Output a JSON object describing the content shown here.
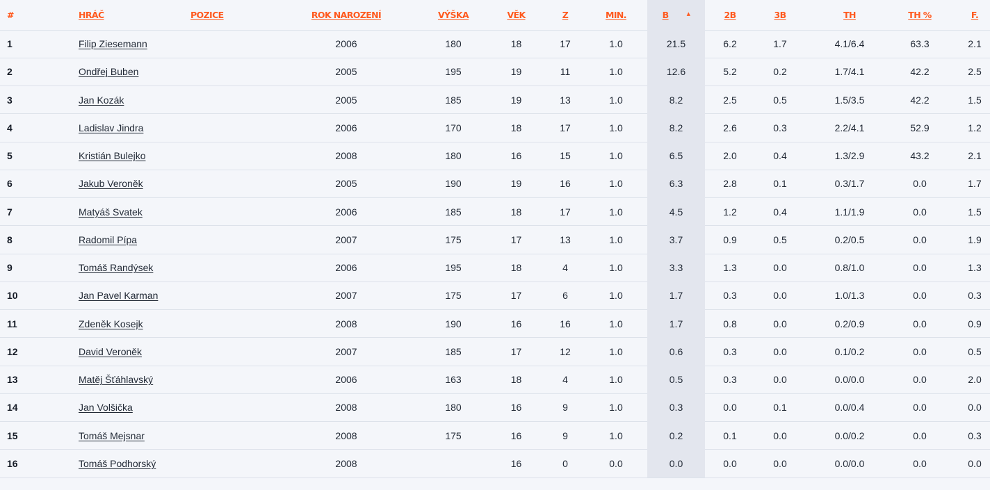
{
  "columns": {
    "rank": "#",
    "player": "HRÁČ",
    "position": "POZICE",
    "birth_year": "ROK NAROZENÍ",
    "height": "VÝŠKA",
    "age": "VĚK",
    "games": "Z",
    "minutes": "MIN.",
    "points": "B",
    "two_pt": "2B",
    "three_pt": "3B",
    "free_throws": "TH",
    "free_throw_pct": "TH %",
    "fouls": "F."
  },
  "sort": {
    "column": "points",
    "direction": "desc",
    "icon": "sort-triangle-up-icon"
  },
  "colors": {
    "accent": "#ff5a1f",
    "sorted_column_bg": "#e3e6ee",
    "page_bg": "#f4f6fa"
  },
  "rows": [
    {
      "rank": "1",
      "player": "Filip Ziesemann",
      "position": "",
      "birth_year": "2006",
      "height": "180",
      "age": "18",
      "games": "17",
      "minutes": "1.0",
      "points": "21.5",
      "two_pt": "6.2",
      "three_pt": "1.7",
      "free_throws": "4.1/6.4",
      "free_throw_pct": "63.3",
      "fouls": "2.1"
    },
    {
      "rank": "2",
      "player": "Ondřej Buben",
      "position": "",
      "birth_year": "2005",
      "height": "195",
      "age": "19",
      "games": "11",
      "minutes": "1.0",
      "points": "12.6",
      "two_pt": "5.2",
      "three_pt": "0.2",
      "free_throws": "1.7/4.1",
      "free_throw_pct": "42.2",
      "fouls": "2.5"
    },
    {
      "rank": "3",
      "player": "Jan Kozák",
      "position": "",
      "birth_year": "2005",
      "height": "185",
      "age": "19",
      "games": "13",
      "minutes": "1.0",
      "points": "8.2",
      "two_pt": "2.5",
      "three_pt": "0.5",
      "free_throws": "1.5/3.5",
      "free_throw_pct": "42.2",
      "fouls": "1.5"
    },
    {
      "rank": "4",
      "player": "Ladislav Jindra",
      "position": "",
      "birth_year": "2006",
      "height": "170",
      "age": "18",
      "games": "17",
      "minutes": "1.0",
      "points": "8.2",
      "two_pt": "2.6",
      "three_pt": "0.3",
      "free_throws": "2.2/4.1",
      "free_throw_pct": "52.9",
      "fouls": "1.2"
    },
    {
      "rank": "5",
      "player": "Kristián Bulejko",
      "position": "",
      "birth_year": "2008",
      "height": "180",
      "age": "16",
      "games": "15",
      "minutes": "1.0",
      "points": "6.5",
      "two_pt": "2.0",
      "three_pt": "0.4",
      "free_throws": "1.3/2.9",
      "free_throw_pct": "43.2",
      "fouls": "2.1"
    },
    {
      "rank": "6",
      "player": "Jakub Veroněk",
      "position": "",
      "birth_year": "2005",
      "height": "190",
      "age": "19",
      "games": "16",
      "minutes": "1.0",
      "points": "6.3",
      "two_pt": "2.8",
      "three_pt": "0.1",
      "free_throws": "0.3/1.7",
      "free_throw_pct": "0.0",
      "fouls": "1.7"
    },
    {
      "rank": "7",
      "player": "Matyáš Svatek",
      "position": "",
      "birth_year": "2006",
      "height": "185",
      "age": "18",
      "games": "17",
      "minutes": "1.0",
      "points": "4.5",
      "two_pt": "1.2",
      "three_pt": "0.4",
      "free_throws": "1.1/1.9",
      "free_throw_pct": "0.0",
      "fouls": "1.5"
    },
    {
      "rank": "8",
      "player": "Radomil Pípa",
      "position": "",
      "birth_year": "2007",
      "height": "175",
      "age": "17",
      "games": "13",
      "minutes": "1.0",
      "points": "3.7",
      "two_pt": "0.9",
      "three_pt": "0.5",
      "free_throws": "0.2/0.5",
      "free_throw_pct": "0.0",
      "fouls": "1.9"
    },
    {
      "rank": "9",
      "player": "Tomáš Randýsek",
      "position": "",
      "birth_year": "2006",
      "height": "195",
      "age": "18",
      "games": "4",
      "minutes": "1.0",
      "points": "3.3",
      "two_pt": "1.3",
      "three_pt": "0.0",
      "free_throws": "0.8/1.0",
      "free_throw_pct": "0.0",
      "fouls": "1.3"
    },
    {
      "rank": "10",
      "player": "Jan Pavel Karman",
      "position": "",
      "birth_year": "2007",
      "height": "175",
      "age": "17",
      "games": "6",
      "minutes": "1.0",
      "points": "1.7",
      "two_pt": "0.3",
      "three_pt": "0.0",
      "free_throws": "1.0/1.3",
      "free_throw_pct": "0.0",
      "fouls": "0.3"
    },
    {
      "rank": "11",
      "player": "Zdeněk Kosejk",
      "position": "",
      "birth_year": "2008",
      "height": "190",
      "age": "16",
      "games": "16",
      "minutes": "1.0",
      "points": "1.7",
      "two_pt": "0.8",
      "three_pt": "0.0",
      "free_throws": "0.2/0.9",
      "free_throw_pct": "0.0",
      "fouls": "0.9"
    },
    {
      "rank": "12",
      "player": "David Veroněk",
      "position": "",
      "birth_year": "2007",
      "height": "185",
      "age": "17",
      "games": "12",
      "minutes": "1.0",
      "points": "0.6",
      "two_pt": "0.3",
      "three_pt": "0.0",
      "free_throws": "0.1/0.2",
      "free_throw_pct": "0.0",
      "fouls": "0.5"
    },
    {
      "rank": "13",
      "player": "Matěj Šťáhlavský",
      "position": "",
      "birth_year": "2006",
      "height": "163",
      "age": "18",
      "games": "4",
      "minutes": "1.0",
      "points": "0.5",
      "two_pt": "0.3",
      "three_pt": "0.0",
      "free_throws": "0.0/0.0",
      "free_throw_pct": "0.0",
      "fouls": "2.0"
    },
    {
      "rank": "14",
      "player": "Jan Volšička",
      "position": "",
      "birth_year": "2008",
      "height": "180",
      "age": "16",
      "games": "9",
      "minutes": "1.0",
      "points": "0.3",
      "two_pt": "0.0",
      "three_pt": "0.1",
      "free_throws": "0.0/0.4",
      "free_throw_pct": "0.0",
      "fouls": "0.0"
    },
    {
      "rank": "15",
      "player": "Tomáš Mejsnar",
      "position": "",
      "birth_year": "2008",
      "height": "175",
      "age": "16",
      "games": "9",
      "minutes": "1.0",
      "points": "0.2",
      "two_pt": "0.1",
      "three_pt": "0.0",
      "free_throws": "0.0/0.2",
      "free_throw_pct": "0.0",
      "fouls": "0.3"
    },
    {
      "rank": "16",
      "player": "Tomáš Podhorský",
      "position": "",
      "birth_year": "2008",
      "height": "",
      "age": "16",
      "games": "0",
      "minutes": "0.0",
      "points": "0.0",
      "two_pt": "0.0",
      "three_pt": "0.0",
      "free_throws": "0.0/0.0",
      "free_throw_pct": "0.0",
      "fouls": "0.0"
    }
  ]
}
